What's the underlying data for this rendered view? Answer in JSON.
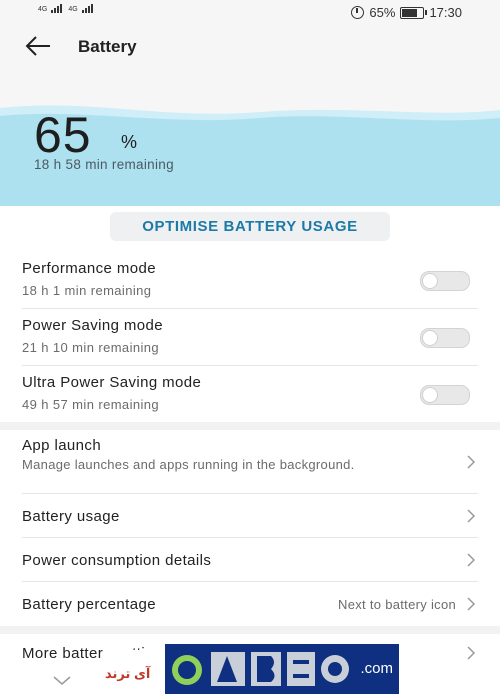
{
  "status_bar": {
    "network_left_1": "4G",
    "network_left_2": "4G",
    "battery_percent_text": "65%",
    "battery_level": 0.65,
    "time": "17:30",
    "icons": [
      "signal-icon",
      "signal-icon",
      "alarm-icon",
      "battery-icon"
    ]
  },
  "header": {
    "title": "Battery",
    "back_icon": "arrow-left-icon"
  },
  "hero": {
    "percent_value": "65",
    "percent_sign": "%",
    "remaining": "18 h 58 min remaining",
    "wave_color": "#aee1f0"
  },
  "optimise": {
    "label": "OPTIMISE BATTERY USAGE",
    "color": "#1c7aa8"
  },
  "modes": [
    {
      "title": "Performance mode",
      "subtitle": "18 h 1 min remaining",
      "enabled": false
    },
    {
      "title": "Power Saving mode",
      "subtitle": "21 h 10 min remaining",
      "enabled": false
    },
    {
      "title": "Ultra Power Saving mode",
      "subtitle": "49 h 57 min remaining",
      "enabled": false
    }
  ],
  "nav": {
    "app_launch": {
      "title": "App launch",
      "description": "Manage launches and apps running in the background."
    },
    "battery_usage": {
      "title": "Battery usage"
    },
    "power_consumption": {
      "title": "Power consumption details"
    },
    "battery_percentage": {
      "title": "Battery percentage",
      "value": "Next to battery icon"
    },
    "more": {
      "title": "More battery settings"
    }
  },
  "watermark": {
    "left_text": "آی ترند",
    "right_text": ".com"
  }
}
